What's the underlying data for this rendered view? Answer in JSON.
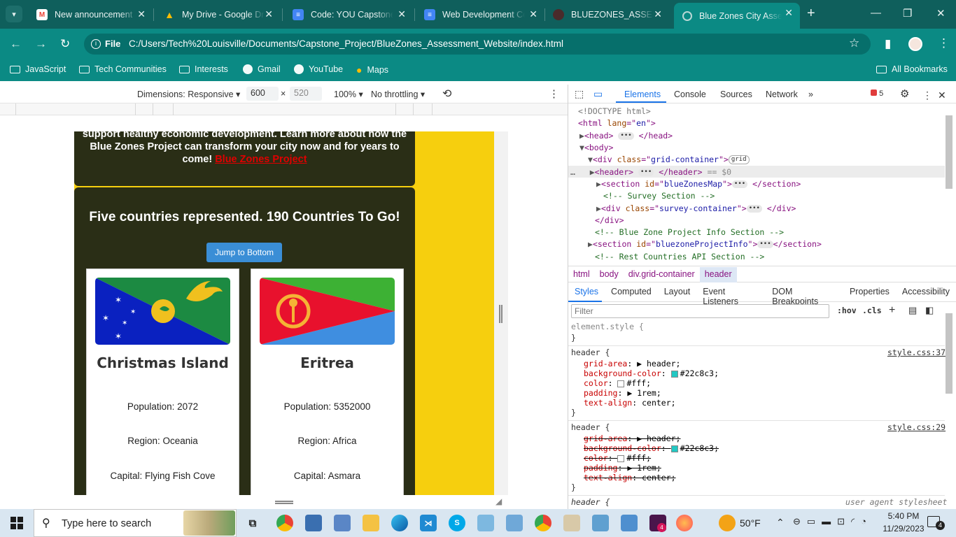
{
  "tabs": [
    {
      "title": "New announcement",
      "icon": "gmail-icon",
      "color": "#ea4335",
      "glyph": "M"
    },
    {
      "title": "My Drive - Google Dr",
      "icon": "drive-icon",
      "color": "#34a853",
      "glyph": "▲"
    },
    {
      "title": "Code: YOU Capstone",
      "icon": "docs-icon",
      "color": "#4285f4",
      "glyph": "≡"
    },
    {
      "title": "Web Development Co",
      "icon": "docs-icon",
      "color": "#4285f4",
      "glyph": "≡"
    },
    {
      "title": "BLUEZONES_ASSESSM",
      "icon": "github-icon",
      "color": "#4a2b2b",
      "glyph": ""
    },
    {
      "title": "Blue Zones City Asses",
      "icon": "globe-icon",
      "color": "#b9d7d5",
      "glyph": ""
    }
  ],
  "address": {
    "chip": "File",
    "url": "C:/Users/Tech%20Louisville/Documents/Capstone_Project/BlueZones_Assessment_Website/index.html"
  },
  "bookmarks": [
    "JavaScript",
    "Tech Communities",
    "Interests",
    "Gmail",
    "YouTube",
    "Maps"
  ],
  "all_bookmarks": "All Bookmarks",
  "device_toolbar": {
    "dimensions": "Dimensions: Responsive",
    "width": "600",
    "times": "×",
    "height": "520",
    "zoom": "100%",
    "throttling": "No throttling"
  },
  "page": {
    "intro_line1": "support healthy economic development. Learn more about how the",
    "intro_line2": "Blue Zones Project can transform your city now and for years to",
    "intro_line3": "come!",
    "intro_link": "Blue Zones Project",
    "heading": "Five countries represented. 190 Countries To Go!",
    "jump_button": "Jump to Bottom",
    "countries": [
      {
        "name": "Christmas Island",
        "population": "Population: 2072",
        "region": "Region: Oceania",
        "capital": "Capital: Flying Fish Cove"
      },
      {
        "name": "Eritrea",
        "population": "Population: 5352000",
        "region": "Region: Africa",
        "capital": "Capital: Asmara"
      }
    ]
  },
  "devtools": {
    "tabs": [
      "Elements",
      "Console",
      "Sources",
      "Network"
    ],
    "error_count": "5",
    "breadcrumbs": [
      "html",
      "body",
      "div.grid-container",
      "header"
    ],
    "style_tabs": [
      "Styles",
      "Computed",
      "Layout",
      "Event Listeners",
      "DOM Breakpoints",
      "Properties",
      "Accessibility"
    ],
    "filter_placeholder": "Filter",
    "hov": ":hov",
    "cls": ".cls",
    "source1": "style.css:37",
    "source2": "style.css:29",
    "source3": "user agent stylesheet"
  },
  "taskbar": {
    "search_placeholder": "Type here to search",
    "temperature": "50°F",
    "time": "5:40 PM",
    "date": "11/29/2023",
    "notifications": "4"
  }
}
